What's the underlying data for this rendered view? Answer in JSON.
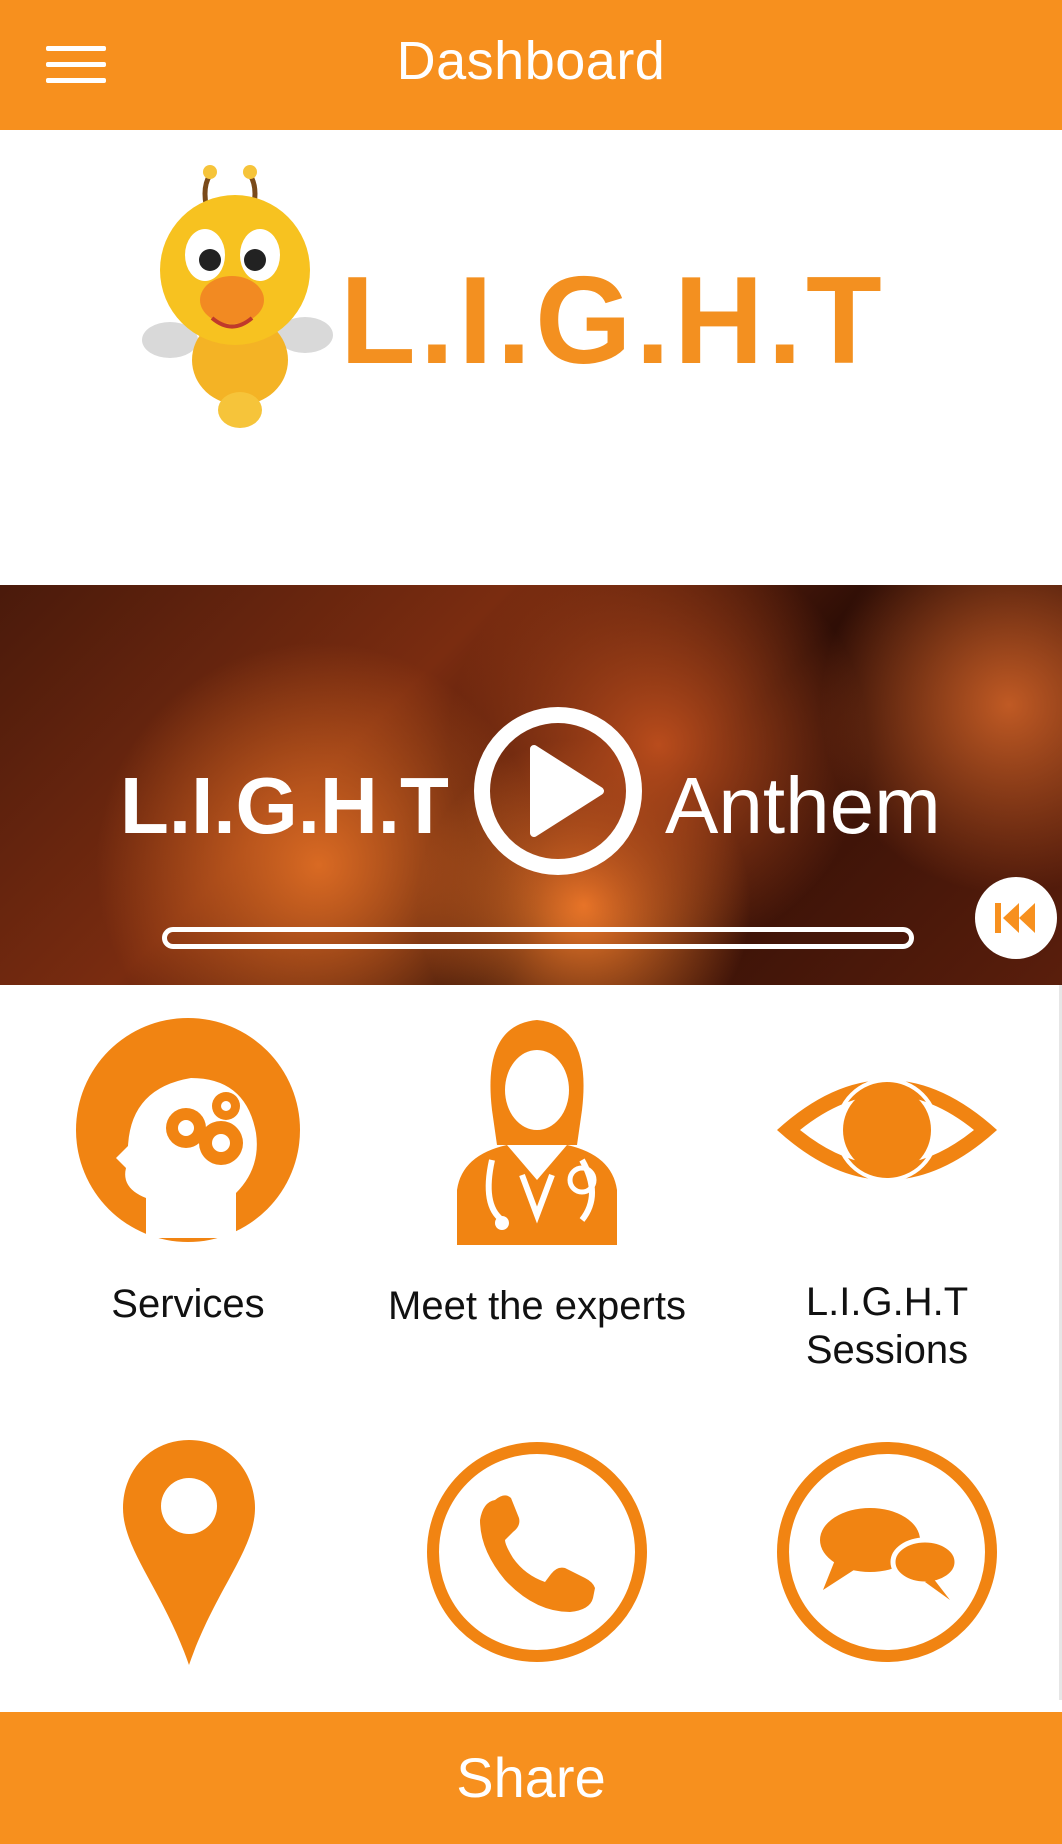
{
  "header": {
    "title": "Dashboard",
    "menu_icon": "hamburger-menu-icon"
  },
  "logo": {
    "text": "L.I.G.H.T",
    "mascot": "bee-mascot"
  },
  "banner": {
    "title_left": "L.I.G.H.T",
    "title_right": "Anthem",
    "progress": 0,
    "play_icon": "play-icon",
    "rewind_icon": "rewind-icon"
  },
  "menu": [
    {
      "label": "Services",
      "icon": "brain-gears-icon"
    },
    {
      "label": "Meet the experts",
      "icon": "doctor-icon"
    },
    {
      "label": "L.I.G.H.T Sessions",
      "line1": "L.I.G.H.T",
      "line2": "Sessions",
      "icon": "eye-icon"
    },
    {
      "label": "",
      "icon": "location-pin-icon"
    },
    {
      "label": "",
      "icon": "phone-icon"
    },
    {
      "label": "",
      "icon": "chat-bubbles-icon"
    }
  ],
  "footer": {
    "share_label": "Share"
  },
  "colors": {
    "accent": "#F7901E",
    "icon_orange": "#F18412"
  }
}
